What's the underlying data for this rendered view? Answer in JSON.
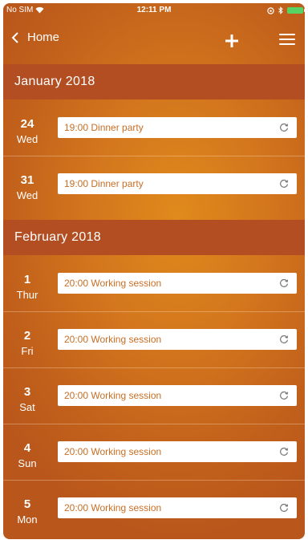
{
  "status_bar": {
    "carrier": "No SIM",
    "time": "12:11 PM",
    "battery_color": "#56d363"
  },
  "nav": {
    "back_label": "Home",
    "add_icon": "plus-icon",
    "menu_icon": "hamburger-menu-icon"
  },
  "colors": {
    "accent": "#d3761d",
    "month_header_bg": "#b24e22",
    "event_text": "#c86e24"
  },
  "months": [
    {
      "label": "January 2018",
      "days": [
        {
          "num": "24",
          "name": "Wed",
          "event": "19:00  Dinner party"
        },
        {
          "num": "31",
          "name": "Wed",
          "event": "19:00  Dinner party"
        }
      ]
    },
    {
      "label": "February 2018",
      "days": [
        {
          "num": "1",
          "name": "Thur",
          "event": "20:00  Working session"
        },
        {
          "num": "2",
          "name": "Fri",
          "event": "20:00  Working session"
        },
        {
          "num": "3",
          "name": "Sat",
          "event": "20:00  Working session"
        },
        {
          "num": "4",
          "name": "Sun",
          "event": "20:00  Working session"
        },
        {
          "num": "5",
          "name": "Mon",
          "event": "20:00  Working session"
        }
      ]
    }
  ]
}
